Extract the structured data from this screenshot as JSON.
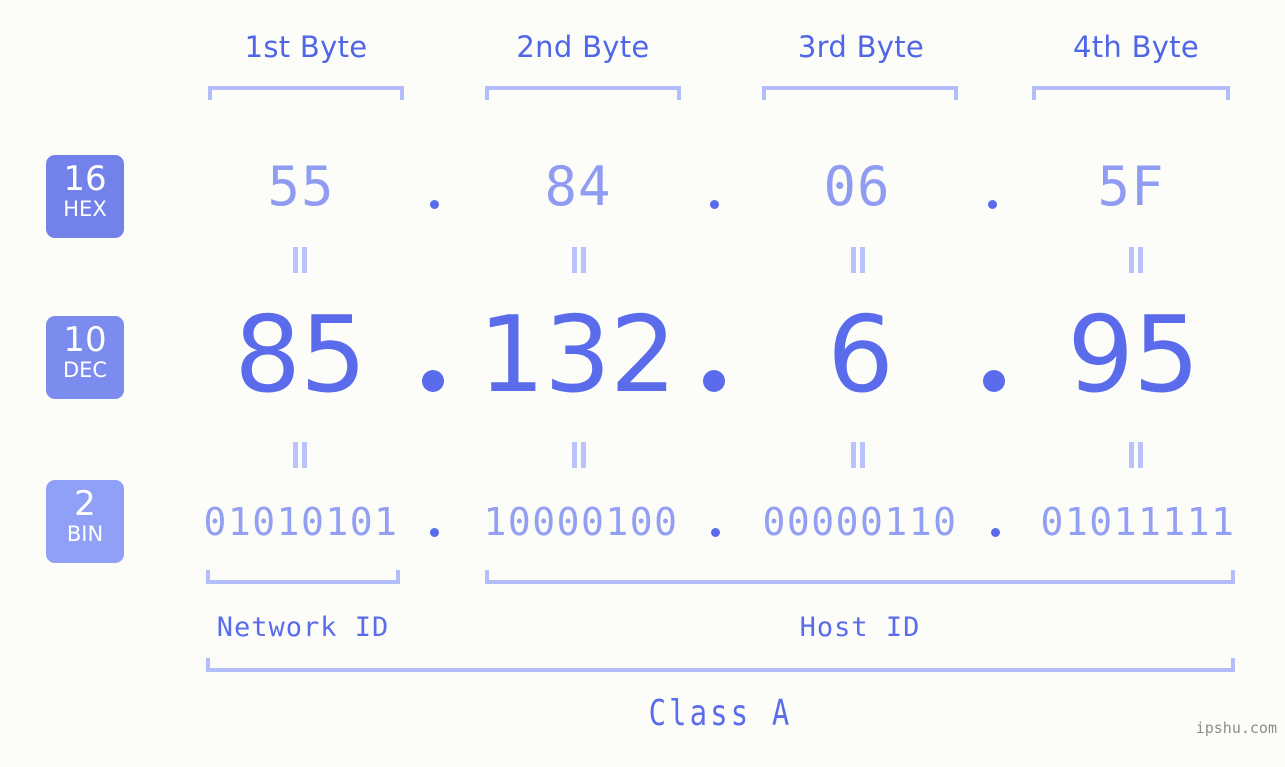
{
  "background": "#fcfdf8",
  "colors": {
    "byte_label": "#4f66e8",
    "bracket": "#b3bdfa",
    "hex_badge": "#7282ea",
    "dec_badge": "#7b8bee",
    "bin_badge": "#8fa0f6",
    "hex_value": "#8f9cf2",
    "dec_value": "#5a6ceb",
    "bin_value": "#939ff3",
    "separator_dot": "#5a6ceb",
    "equals_mark": "#b9c2fb",
    "id_label": "#5a6ceb",
    "watermark": "#8d8d8d"
  },
  "byte_headers": [
    {
      "label": "1st Byte"
    },
    {
      "label": "2nd Byte"
    },
    {
      "label": "3rd Byte"
    },
    {
      "label": "4th Byte"
    }
  ],
  "bases": [
    {
      "number": "16",
      "name": "HEX"
    },
    {
      "number": "10",
      "name": "DEC"
    },
    {
      "number": "2",
      "name": "BIN"
    }
  ],
  "rows": {
    "hex": {
      "values": [
        "55",
        "84",
        "06",
        "5F"
      ],
      "separator": "."
    },
    "dec": {
      "values": [
        "85",
        "132",
        "6",
        "95"
      ],
      "separator": "."
    },
    "bin": {
      "values": [
        "01010101",
        "10000100",
        "00000110",
        "01011111"
      ],
      "separator": "."
    }
  },
  "equals_symbol": "=",
  "segments": {
    "network_id": "Network ID",
    "host_id": "Host ID",
    "class": "Class A"
  },
  "watermark": "ipshu.com"
}
